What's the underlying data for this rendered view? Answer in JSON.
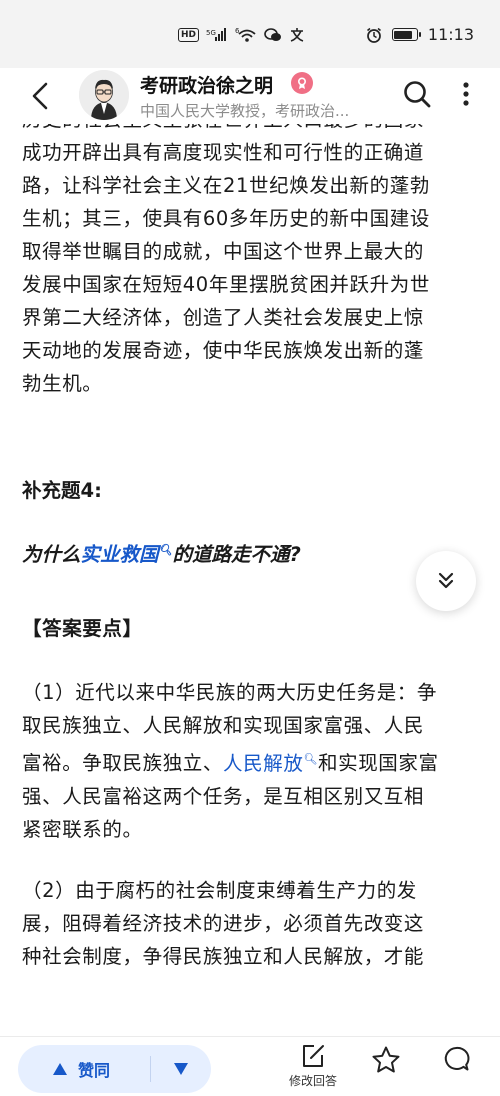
{
  "status_bar": {
    "network_badge": "HD",
    "signal_label": "5G",
    "wifi_label": "6",
    "time": "11:13"
  },
  "header": {
    "author_name": "考研政治徐之明",
    "author_desc": "中国人民大学教授，考研政治...",
    "icons": [
      "back-arrow-icon",
      "avatar",
      "verified-badge-icon",
      "search-icon",
      "more-vertical-icon"
    ]
  },
  "article": {
    "cut_line": "历史的社会主义主张在世界上人口最多的国家",
    "para1_lines": [
      "成功开辟出具有高度现实性和可行性的正确道",
      "路，让科学社会主义在21世纪焕发出新的蓬勃",
      "生机；其三，使具有60多年历史的新中国建设",
      "取得举世瞩目的成就，中国这个世界上最大的",
      "发展中国家在短短40年里摆脱贫困并跃升为世",
      "界第二大经济体，创造了人类社会发展史上惊",
      "天动地的发展奇迹，使中华民族焕发出新的蓬",
      "勃生机。"
    ],
    "section_title": "补充题4:",
    "question_prefix": "为什么",
    "question_link": "实业救国",
    "question_suffix": "的道路走不通?",
    "answer_heading": "【答案要点】",
    "point1_lines": [
      "（1）近代以来中华民族的两大历史任务是：争",
      "取民族独立、人民解放和实现国家富强、人民",
      "富裕。争取民族独立、"
    ],
    "point1_link": "人民解放",
    "point1_rest_line3": "和实现国家富",
    "point1_tail_lines": [
      "强、人民富裕这两个任务，是互相区别又互相",
      "紧密联系的。"
    ],
    "point2_lines": [
      "（2）由于腐朽的社会制度束缚着生产力的发",
      "展，阻碍着经济技术的进步，必须首先改变这",
      "种社会制度，争得民族独立和人民解放，才能"
    ]
  },
  "fold_button": {
    "icon": "double-chevron-down-icon"
  },
  "bottom_bar": {
    "upvote_label": "赞同",
    "edit_label": "修改回答",
    "colors": {
      "accent": "#1758c9",
      "vote_bg": "#e6efff"
    }
  }
}
